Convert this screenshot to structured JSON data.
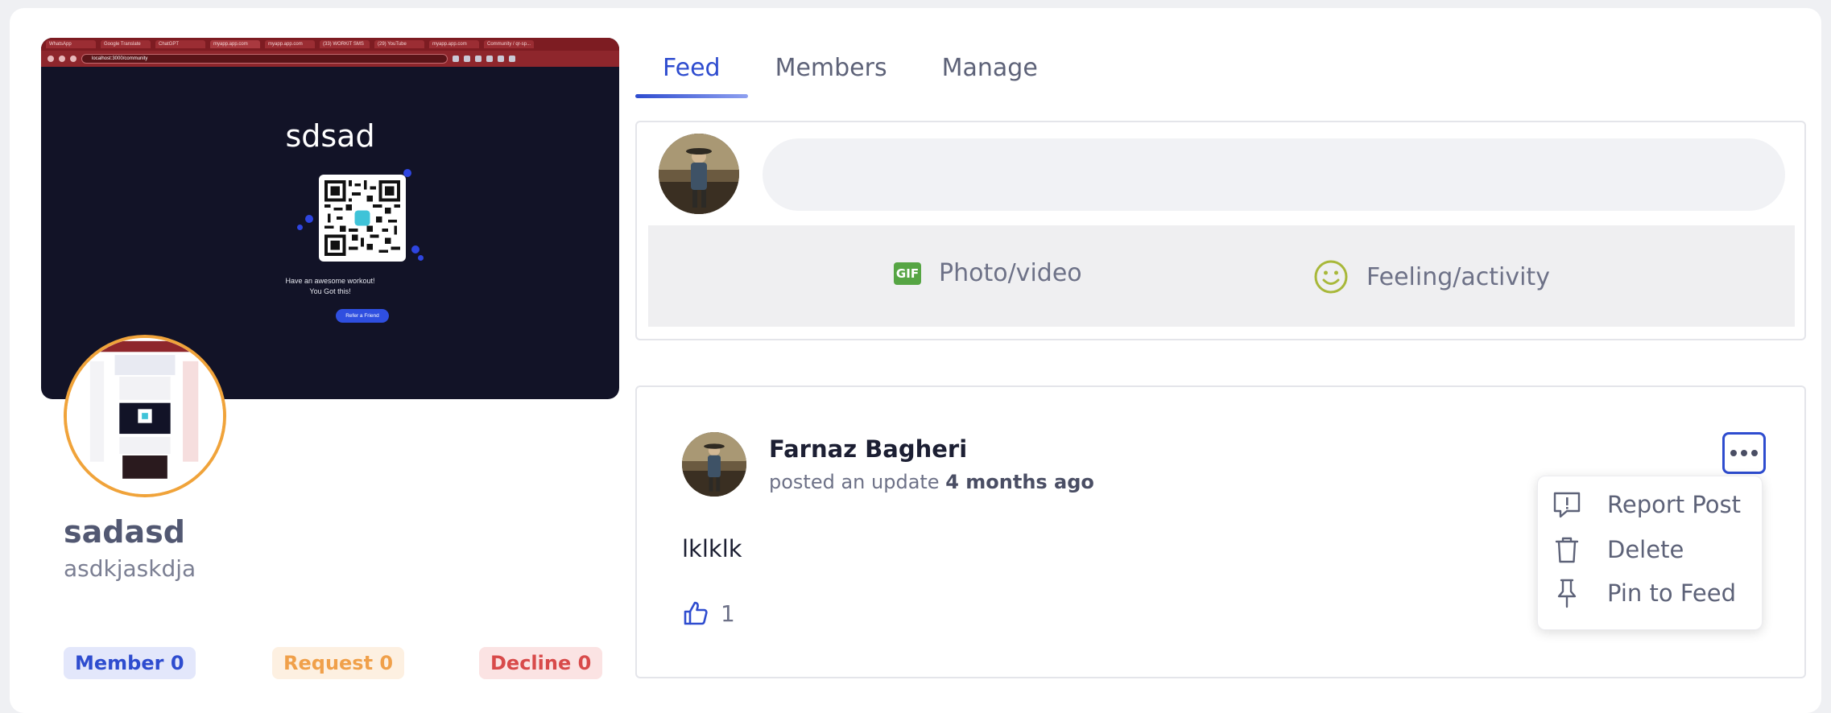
{
  "cover": {
    "browser_tabs": [
      "WhatsApp",
      "Google Translate",
      "ChatGPT",
      "myapp.app.com",
      "myapp.app.com",
      "(33) WORKIT SMS",
      "(29) YouTube",
      "myapp.app.com",
      "Community / qr-sp..."
    ],
    "url": "localhost:3000/community",
    "title": "sdsad",
    "tagline_line1": "Have an awesome workout!",
    "tagline_line2": "You Got this!",
    "button_label": "Refer a Friend"
  },
  "group": {
    "name": "sadasd",
    "description": "asdkjaskdja"
  },
  "stats": {
    "member": "Member 0",
    "request": "Request 0",
    "decline": "Decline 0"
  },
  "tabs": [
    "Feed",
    "Members",
    "Manage"
  ],
  "composer": {
    "placeholder": "",
    "photo_label": "Photo/video",
    "gif_badge": "GIF",
    "feeling_label": "Feeling/activity"
  },
  "post": {
    "author": "Farnaz Bagheri",
    "meta_prefix": "posted an update",
    "meta_time": "4 months ago",
    "body": "lklklk",
    "like_count": "1"
  },
  "menu": {
    "report": "Report Post",
    "delete": "Delete",
    "pin": "Pin to Feed"
  },
  "colors": {
    "accent": "#2e4ccf",
    "avatar_ring": "#f0a33a",
    "request": "#f0a04a",
    "decline": "#d84a4a"
  }
}
